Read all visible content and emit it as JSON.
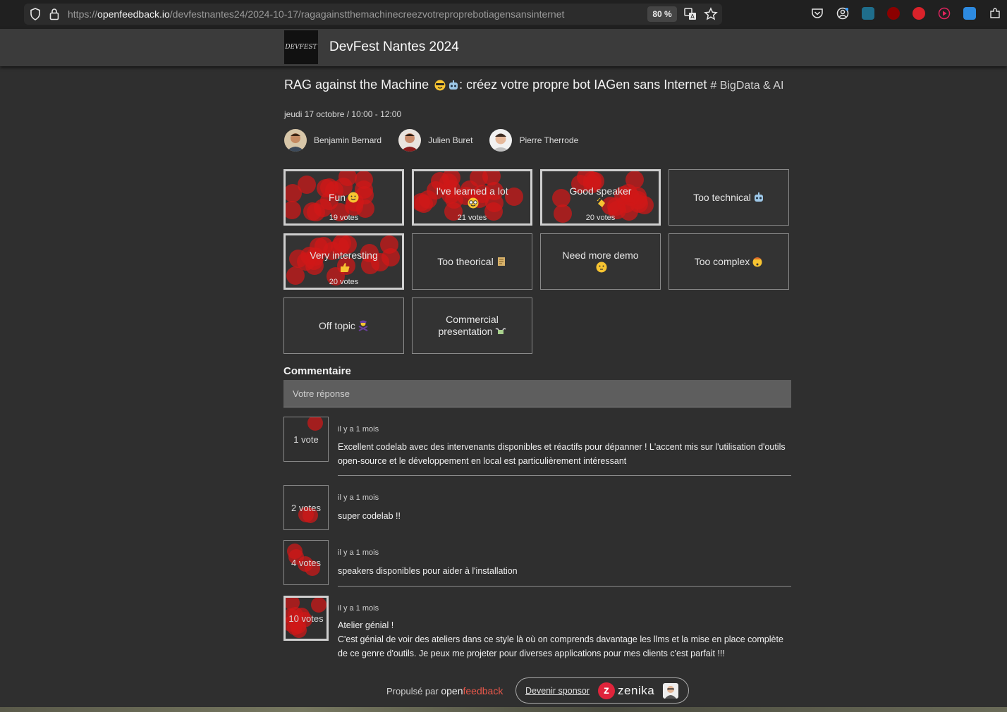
{
  "browser": {
    "url_prefix": "https://",
    "url_host": "openfeedback.io",
    "url_path": "/devfestnantes24/2024-10-17/ragagainstthemachinecreezvotreproprebotiagensansinternet",
    "zoom": "80 %",
    "icons": [
      "shield-icon",
      "lock-icon",
      "translate-icon",
      "star-icon",
      "pocket-icon",
      "account-icon",
      "extension-icon",
      "ublock-icon",
      "abp-icon",
      "play-icon",
      "extension-icon",
      "puzzle-icon"
    ]
  },
  "header": {
    "logo_text": "DEVFEST",
    "event_title": "DevFest Nantes 2024"
  },
  "talk": {
    "title": "RAG against the Machine",
    "title_rest": ": créez votre propre bot IAGen sans Internet",
    "track": "# BigData & AI",
    "date": "jeudi 17 octobre / 10:00 - 12:00",
    "speakers": [
      {
        "name": "Benjamin Bernard"
      },
      {
        "name": "Julien Buret"
      },
      {
        "name": "Pierre Therrode"
      }
    ]
  },
  "votes": [
    {
      "label": "Fun",
      "emoji": "slightly-smiling-face",
      "count_text": "19 votes",
      "count": 19,
      "voted": true
    },
    {
      "label": "I've learned a lot",
      "emoji": "nerd-face",
      "count_text": "21 votes",
      "count": 21,
      "voted": true
    },
    {
      "label": "Good speaker",
      "emoji": "clapping-hands",
      "count_text": "20 votes",
      "count": 20,
      "voted": true
    },
    {
      "label": "Too technical",
      "emoji": "robot-face",
      "count_text": "",
      "count": 0,
      "voted": false
    },
    {
      "label": "Very interesting",
      "emoji": "thumbs-up",
      "count_text": "20 votes",
      "count": 20,
      "voted": true
    },
    {
      "label": "Too theorical",
      "emoji": "scroll",
      "count_text": "",
      "count": 0,
      "voted": false
    },
    {
      "label": "Need more demo",
      "emoji": "thinking-face",
      "count_text": "",
      "count": 0,
      "voted": false
    },
    {
      "label": "Too complex",
      "emoji": "exploding-head",
      "count_text": "",
      "count": 0,
      "voted": false
    },
    {
      "label": "Off topic",
      "emoji": "person-gesturing-no",
      "count_text": "",
      "count": 0,
      "voted": false
    },
    {
      "label": "Commercial presentation",
      "emoji": "money-with-wings",
      "count_text": "",
      "count": 0,
      "voted": false
    }
  ],
  "comments_section": {
    "title": "Commentaire",
    "placeholder": "Votre réponse"
  },
  "comments": [
    {
      "votes_text": "1 vote",
      "votes": 1,
      "voted": false,
      "when": "il y a 1 mois",
      "text": "Excellent codelab avec des intervenants disponibles et réactifs pour dépanner ! L'accent mis sur l'utilisation d'outils open-source et le développement en local est particulièrement intéressant"
    },
    {
      "votes_text": "2 votes",
      "votes": 2,
      "voted": false,
      "when": "il y a 1 mois",
      "text": "super codelab !!"
    },
    {
      "votes_text": "4 votes",
      "votes": 4,
      "voted": false,
      "when": "il y a 1 mois",
      "text": "speakers disponibles pour aider à l'installation"
    },
    {
      "votes_text": "10 votes",
      "votes": 10,
      "voted": true,
      "when": "il y a 1 mois",
      "text_line1": "Atelier génial !",
      "text": "C'est génial de voir des ateliers dans ce style là où on comprends davantage les llms et la mise en place complète de ce genre d'outils. Je peux me projeter pour diverses applications pour mes clients c'est parfait !!!"
    }
  ],
  "footer": {
    "powered_label": "Propulsé par",
    "brand_open": "open",
    "brand_feedback": "feedback",
    "sponsor_link": "Devenir sponsor",
    "sponsor_name": "zenika"
  },
  "colors": {
    "background": "#2f2f2f",
    "header": "#3b3b3b",
    "vote_dot": "#d01818",
    "brand_accent": "#e8574a",
    "zenika": "#e0243b"
  }
}
